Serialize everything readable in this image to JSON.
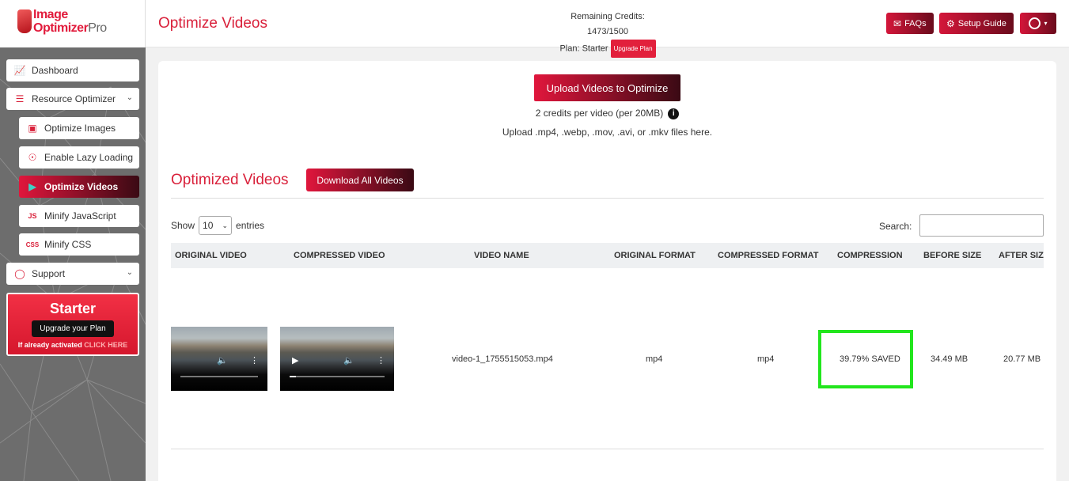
{
  "brand": {
    "line1": "Image",
    "line2": "Optimizer",
    "line2_suffix": "Pro"
  },
  "header": {
    "title": "Optimize Videos",
    "credits": "Remaining Credits: 1473/1500",
    "plan_label": "Plan: Starter",
    "upgrade_badge": "Upgrade Plan",
    "faq": "FAQs",
    "setup": "Setup Guide"
  },
  "sidebar": {
    "items": [
      {
        "label": "Dashboard"
      },
      {
        "label": "Resource Optimizer"
      },
      {
        "label": "Optimize Images"
      },
      {
        "label": "Enable Lazy Loading"
      },
      {
        "label": "Optimize Videos"
      },
      {
        "label": "Minify JavaScript"
      },
      {
        "label": "Minify CSS"
      },
      {
        "label": "Support"
      }
    ],
    "promo": {
      "title": "Starter",
      "button": "Upgrade your Plan",
      "note": "If already activated",
      "link": "CLICK HERE"
    }
  },
  "upload": {
    "button": "Upload Videos to Optimize",
    "credit_note": "2 credits per video (per 20MB)",
    "format_note": "Upload .mp4, .webp, .mov, .avi, or .mkv files here."
  },
  "section": {
    "title": "Optimized Videos",
    "download_all": "Download All Videos"
  },
  "table": {
    "show_label": "Show",
    "entries_value": "10",
    "entries_label": "entries",
    "search_label": "Search:",
    "headers": [
      "ORIGINAL VIDEO",
      "COMPRESSED VIDEO",
      "VIDEO NAME",
      "ORIGINAL FORMAT",
      "COMPRESSED FORMAT",
      "COMPRESSION",
      "BEFORE SIZE",
      "AFTER SIZE"
    ],
    "rows": [
      {
        "video_name": "video-1_1755515053.mp4",
        "original_format": "mp4",
        "compressed_format": "mp4",
        "compression": "39.79% SAVED",
        "before_size": "34.49 MB",
        "after_size": "20.77 MB"
      }
    ]
  },
  "colors": {
    "brand_red": "#d9203a",
    "highlight": "#22e61d"
  }
}
